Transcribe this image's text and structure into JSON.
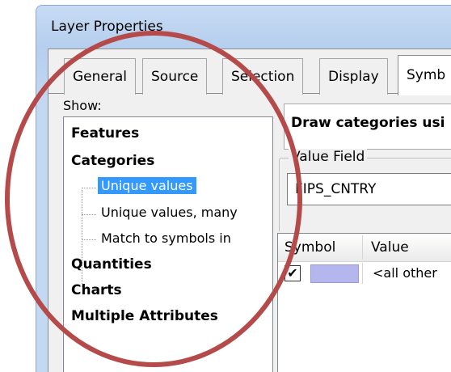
{
  "window": {
    "title": "Layer Properties"
  },
  "tabs": [
    {
      "label": "General",
      "active": false
    },
    {
      "label": "Source",
      "active": false
    },
    {
      "label": "Selection",
      "active": false
    },
    {
      "label": "Display",
      "active": false
    },
    {
      "label": "Symb",
      "active": true
    }
  ],
  "show": {
    "label": "Show:",
    "tree": {
      "features": "Features",
      "categories": "Categories",
      "unique_values": "Unique values",
      "unique_values_many": "Unique values, many",
      "match_symbols": "Match to symbols in",
      "quantities": "Quantities",
      "charts": "Charts",
      "multiple_attributes": "Multiple Attributes"
    }
  },
  "draw_header": "Draw categories usi",
  "value_field": {
    "label": "Value Field",
    "value": "FIPS_CNTRY"
  },
  "grid": {
    "col_symbol": "Symbol",
    "col_value": "Value",
    "rows": [
      {
        "checked": true,
        "value": "<all other"
      }
    ]
  },
  "colors": {
    "swatch": "#b6b6ef",
    "selection": "#3399ff",
    "annotation_ring": "#b54a4a"
  }
}
